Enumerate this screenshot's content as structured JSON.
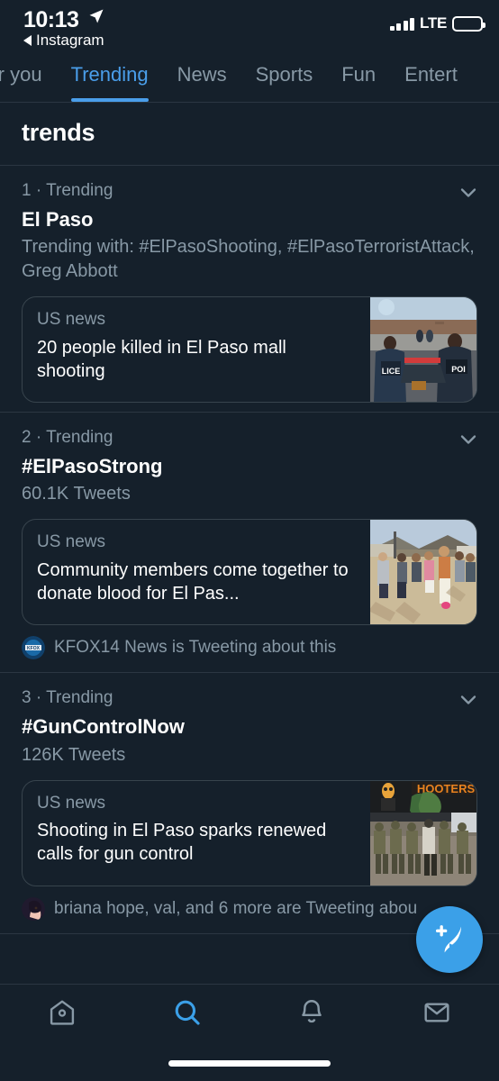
{
  "status_bar": {
    "time": "10:13",
    "location_icon": "location-arrow-icon",
    "back_app_label": "Instagram",
    "carrier": "LTE",
    "signal_icon": "signal-bars-icon",
    "battery_icon": "battery-full-icon"
  },
  "tabs": [
    {
      "label": "For you",
      "active": false
    },
    {
      "label": "Trending",
      "active": true
    },
    {
      "label": "News",
      "active": false
    },
    {
      "label": "Sports",
      "active": false
    },
    {
      "label": "Fun",
      "active": false
    },
    {
      "label": "Entert",
      "active": false
    }
  ],
  "header": {
    "title": "trends"
  },
  "trends": [
    {
      "rank": "1 · Trending",
      "name": "El Paso",
      "subtitle": "Trending with: #ElPasoShooting, #ElPasoTerroristAttack, Greg Abbott",
      "chevron_icon": "chevron-down-icon",
      "news": {
        "category": "US news",
        "title": "20 people killed in El Paso mall shooting",
        "thumbnail": "police-officers-at-mall-photo"
      },
      "social_proof": null
    },
    {
      "rank": "2 · Trending",
      "name": "#ElPasoStrong",
      "subtitle": "60.1K Tweets",
      "chevron_icon": "chevron-down-icon",
      "news": {
        "category": "US news",
        "title": "Community members come together to donate blood for El Pas...",
        "thumbnail": "blood-donation-line-photo"
      },
      "social_proof": {
        "text": "KFOX14 News is Tweeting about this",
        "avatar": "kfox14-news-avatar"
      }
    },
    {
      "rank": "3 · Trending",
      "name": "#GunControlNow",
      "subtitle": "126K Tweets",
      "chevron_icon": "chevron-down-icon",
      "news": {
        "category": "US news",
        "title": "Shooting in El Paso sparks renewed calls for gun control",
        "thumbnail": "police-at-hooters-photo"
      },
      "social_proof": {
        "text": "briana hope, val, and 6 more are Tweeting abou",
        "avatar": "briana-hope-avatar"
      }
    }
  ],
  "compose": {
    "icon": "compose-tweet-icon"
  },
  "bottom_nav": [
    {
      "icon": "home-icon",
      "active": false
    },
    {
      "icon": "search-icon",
      "active": true
    },
    {
      "icon": "bell-icon",
      "active": false
    },
    {
      "icon": "messages-icon",
      "active": false
    }
  ],
  "colors": {
    "background": "#15202b",
    "accent": "#3ba0e8",
    "muted_text": "#8899a6",
    "divider": "#2b3642"
  }
}
